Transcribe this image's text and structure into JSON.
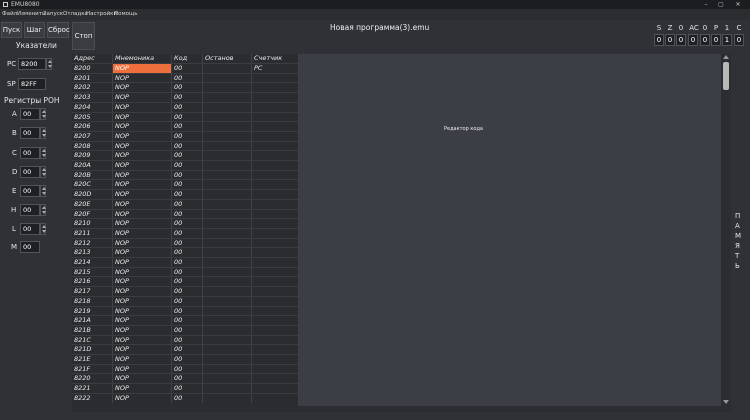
{
  "window": {
    "title": "EMU8080",
    "min": "–",
    "max": "▢",
    "close": "✕"
  },
  "menu": [
    "Файл",
    "Изменить",
    "Запуск",
    "Отладка",
    "Настройки",
    "Помощь"
  ],
  "toolbar": {
    "run": "Пуск",
    "step": "Шаг",
    "reset": "Сброс",
    "stop": "Стоп"
  },
  "program_title": "Новая программа(3).emu",
  "pointers": {
    "heading": "Указатели",
    "pc_label": "PC",
    "pc_value": "8200",
    "sp_label": "SP",
    "sp_value": "82FF"
  },
  "registers": {
    "heading": "Регистры РОН",
    "items": [
      {
        "name": "A",
        "value": "00"
      },
      {
        "name": "B",
        "value": "00"
      },
      {
        "name": "C",
        "value": "00"
      },
      {
        "name": "D",
        "value": "00"
      },
      {
        "name": "E",
        "value": "00"
      },
      {
        "name": "H",
        "value": "00"
      },
      {
        "name": "L",
        "value": "00"
      },
      {
        "name": "M",
        "value": "00"
      }
    ]
  },
  "flags": {
    "labels": [
      "S",
      "Z",
      "0",
      "AC",
      "0",
      "P",
      "1",
      "C"
    ],
    "values": [
      "0",
      "0",
      "0",
      "0",
      "0",
      "0",
      "1",
      "0"
    ]
  },
  "table": {
    "headers": {
      "addr": "Адрес",
      "mnem": "Мнемоника",
      "code": "Код",
      "stop": "Останов",
      "counter": "Счетчик"
    },
    "counter_marker": "PC",
    "rows": [
      {
        "addr": "8200",
        "mnem": "NOP",
        "code": "00"
      },
      {
        "addr": "8201",
        "mnem": "NOP",
        "code": "00"
      },
      {
        "addr": "8202",
        "mnem": "NOP",
        "code": "00"
      },
      {
        "addr": "8203",
        "mnem": "NOP",
        "code": "00"
      },
      {
        "addr": "8204",
        "mnem": "NOP",
        "code": "00"
      },
      {
        "addr": "8205",
        "mnem": "NOP",
        "code": "00"
      },
      {
        "addr": "8206",
        "mnem": "NOP",
        "code": "00"
      },
      {
        "addr": "8207",
        "mnem": "NOP",
        "code": "00"
      },
      {
        "addr": "8208",
        "mnem": "NOP",
        "code": "00"
      },
      {
        "addr": "8209",
        "mnem": "NOP",
        "code": "00"
      },
      {
        "addr": "820A",
        "mnem": "NOP",
        "code": "00"
      },
      {
        "addr": "820B",
        "mnem": "NOP",
        "code": "00"
      },
      {
        "addr": "820C",
        "mnem": "NOP",
        "code": "00"
      },
      {
        "addr": "820D",
        "mnem": "NOP",
        "code": "00"
      },
      {
        "addr": "820E",
        "mnem": "NOP",
        "code": "00"
      },
      {
        "addr": "820F",
        "mnem": "NOP",
        "code": "00"
      },
      {
        "addr": "8210",
        "mnem": "NOP",
        "code": "00"
      },
      {
        "addr": "8211",
        "mnem": "NOP",
        "code": "00"
      },
      {
        "addr": "8212",
        "mnem": "NOP",
        "code": "00"
      },
      {
        "addr": "8213",
        "mnem": "NOP",
        "code": "00"
      },
      {
        "addr": "8214",
        "mnem": "NOP",
        "code": "00"
      },
      {
        "addr": "8215",
        "mnem": "NOP",
        "code": "00"
      },
      {
        "addr": "8216",
        "mnem": "NOP",
        "code": "00"
      },
      {
        "addr": "8217",
        "mnem": "NOP",
        "code": "00"
      },
      {
        "addr": "8218",
        "mnem": "NOP",
        "code": "00"
      },
      {
        "addr": "8219",
        "mnem": "NOP",
        "code": "00"
      },
      {
        "addr": "821A",
        "mnem": "NOP",
        "code": "00"
      },
      {
        "addr": "821B",
        "mnem": "NOP",
        "code": "00"
      },
      {
        "addr": "821C",
        "mnem": "NOP",
        "code": "00"
      },
      {
        "addr": "821D",
        "mnem": "NOP",
        "code": "00"
      },
      {
        "addr": "821E",
        "mnem": "NOP",
        "code": "00"
      },
      {
        "addr": "821F",
        "mnem": "NOP",
        "code": "00"
      },
      {
        "addr": "8220",
        "mnem": "NOP",
        "code": "00"
      },
      {
        "addr": "8221",
        "mnem": "NOP",
        "code": "00"
      },
      {
        "addr": "8222",
        "mnem": "NOP",
        "code": "00"
      }
    ]
  },
  "editor": {
    "label": "Редактор кода"
  },
  "memory_panel": {
    "letters": [
      "П",
      "А",
      "М",
      "Я",
      "Т",
      "Ь"
    ]
  }
}
